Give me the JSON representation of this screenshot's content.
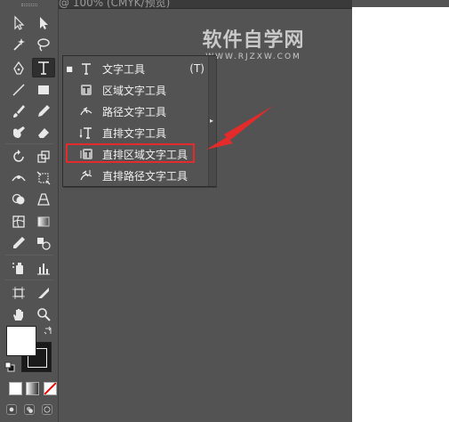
{
  "document": {
    "tab_title": "@ 100% (CMYK/预览)"
  },
  "watermark": {
    "title": "软件自学网",
    "url": "WWW.RJZXW.COM"
  },
  "flyout": {
    "items": [
      {
        "label": "文字工具",
        "shortcut": "(T)",
        "icon": "type-icon",
        "checked": true
      },
      {
        "label": "区域文字工具",
        "icon": "area-type-icon",
        "checked": false
      },
      {
        "label": "路径文字工具",
        "icon": "type-on-path-icon",
        "checked": false
      },
      {
        "label": "直排文字工具",
        "icon": "vertical-type-icon",
        "checked": false
      },
      {
        "label": "直排区域文字工具",
        "icon": "vertical-area-type-icon",
        "checked": false
      },
      {
        "label": "直排路径文字工具",
        "icon": "vertical-type-on-path-icon",
        "checked": false
      }
    ],
    "check_glyph": "■",
    "tearoff_glyph": "▸"
  },
  "colors": {
    "highlight": "#e32b2b",
    "panel": "#535353",
    "artboard": "#ffffff"
  }
}
